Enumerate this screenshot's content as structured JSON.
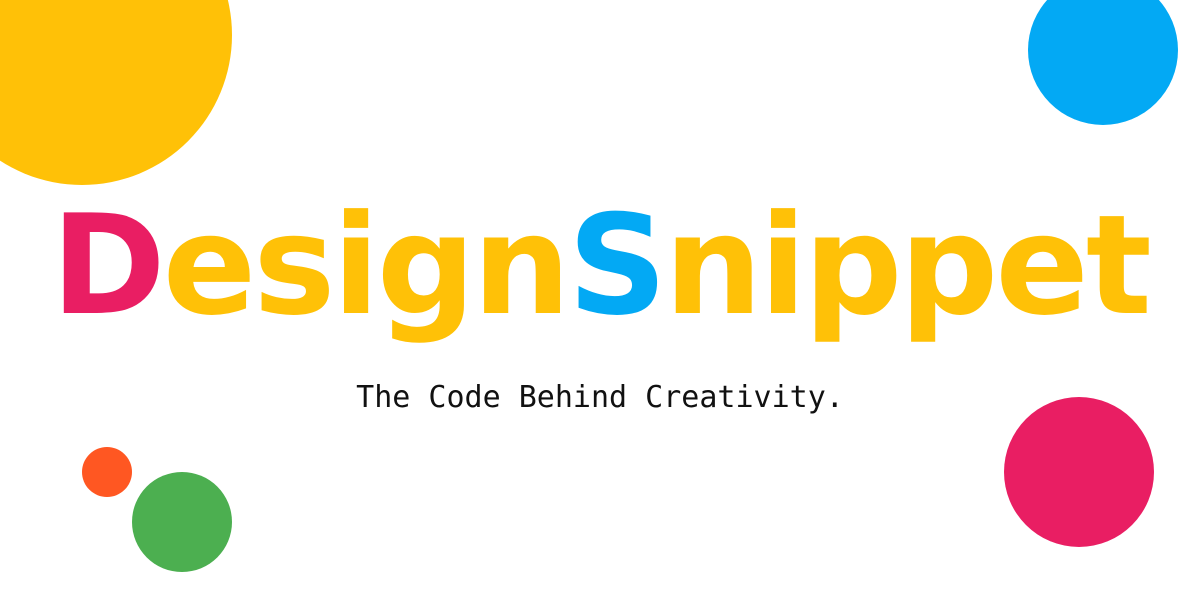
{
  "banner": {
    "brand_parts": [
      {
        "text": "D",
        "color": "#E91E63"
      },
      {
        "text": "esign",
        "color": "#FFC107"
      },
      {
        "text": "S",
        "color": "#03A9F4"
      },
      {
        "text": "nippet",
        "color": "#FFC107"
      }
    ],
    "tagline": "The Code Behind Creativity.",
    "decorations": [
      {
        "name": "yellow-circle",
        "color": "#FFC107"
      },
      {
        "name": "blue-circle",
        "color": "#03A9F4"
      },
      {
        "name": "pink-circle",
        "color": "#E91E63"
      },
      {
        "name": "orange-circle",
        "color": "#FF5722"
      },
      {
        "name": "green-circle",
        "color": "#4CAF50"
      }
    ]
  }
}
